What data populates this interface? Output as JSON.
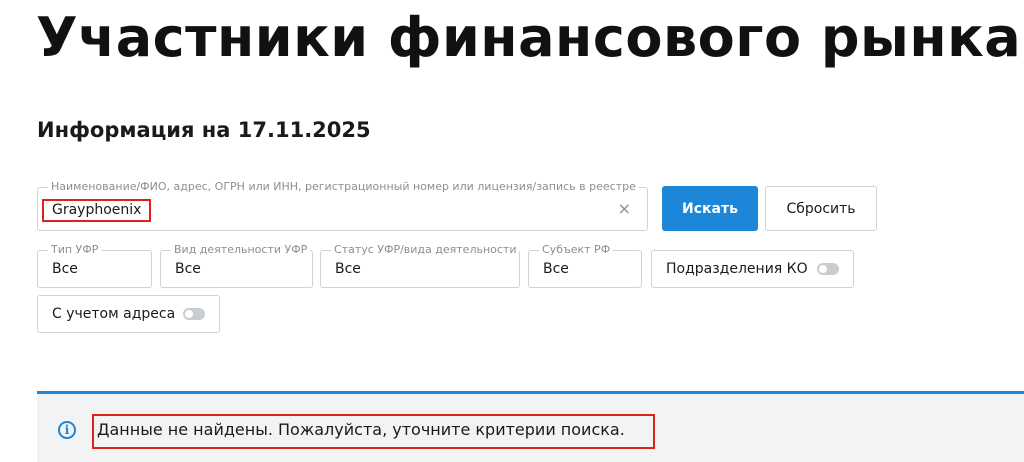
{
  "page": {
    "title": "Участники финансового рынка",
    "info_date": "Информация на 17.11.2025"
  },
  "search": {
    "label": "Наименование/ФИО, адрес, ОГРН или ИНН, регистрационный номер или лицензия/запись в реестре",
    "value": "Grayphoenix",
    "clear_icon": "×",
    "search_button": "Искать",
    "reset_button": "Сбросить"
  },
  "filters": [
    {
      "label": "Тип УФР",
      "value": "Все"
    },
    {
      "label": "Вид деятельности УФР",
      "value": "Все"
    },
    {
      "label": "Статус УФР/вида деятельности",
      "value": "Все"
    },
    {
      "label": "Субъект РФ",
      "value": "Все"
    }
  ],
  "toggles": {
    "ko_divisions": {
      "label": "Подразделения КО",
      "on": false
    },
    "with_address": {
      "label": "С учетом адреса",
      "on": false
    }
  },
  "alert": {
    "icon": "info-icon",
    "icon_glyph": "i",
    "message": "Данные не найдены. Пожалуйста, уточните критерии поиска."
  },
  "colors": {
    "accent": "#1c87d8",
    "highlight": "#e0201c",
    "alert_bg": "#f1f3f5"
  }
}
